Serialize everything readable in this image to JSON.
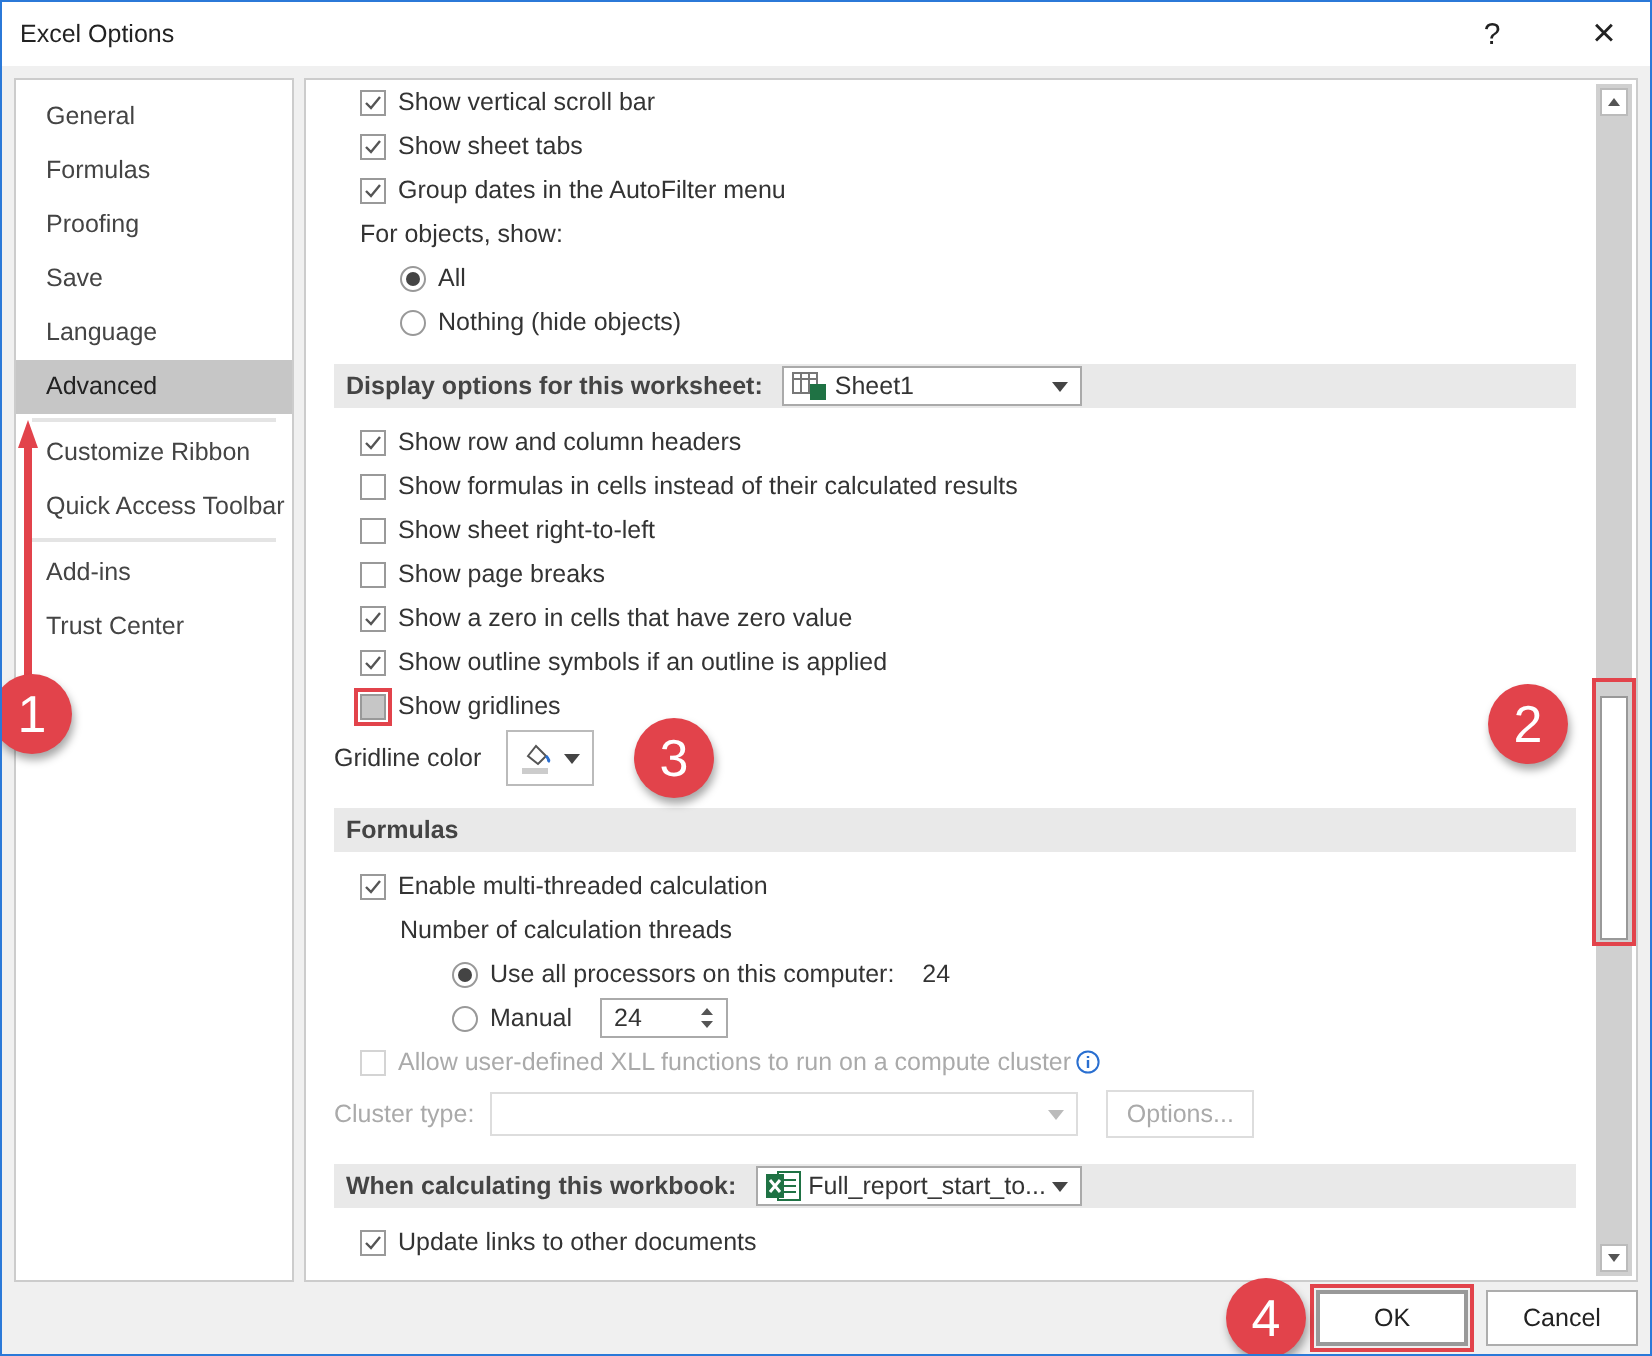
{
  "window": {
    "title": "Excel Options",
    "help": "?",
    "close": "×"
  },
  "sidebar": {
    "groups": [
      [
        {
          "label": "General",
          "selected": false
        },
        {
          "label": "Formulas",
          "selected": false
        },
        {
          "label": "Proofing",
          "selected": false
        },
        {
          "label": "Save",
          "selected": false
        },
        {
          "label": "Language",
          "selected": false
        },
        {
          "label": "Advanced",
          "selected": true
        }
      ],
      [
        {
          "label": "Customize Ribbon",
          "selected": false
        },
        {
          "label": "Quick Access Toolbar",
          "selected": false
        }
      ],
      [
        {
          "label": "Add-ins",
          "selected": false
        },
        {
          "label": "Trust Center",
          "selected": false
        }
      ]
    ]
  },
  "content": {
    "items": [
      {
        "kind": "checkbox",
        "label": "Show vertical scroll bar",
        "checked": true,
        "disabled": false,
        "highlighted": false
      },
      {
        "kind": "checkbox",
        "label": "Show sheet tabs",
        "checked": true,
        "disabled": false,
        "highlighted": false
      },
      {
        "kind": "checkbox",
        "label": "Group dates in the AutoFilter menu",
        "checked": true,
        "disabled": false,
        "highlighted": false
      },
      {
        "kind": "caption",
        "label": "For objects, show:",
        "children": [
          {
            "kind": "radio",
            "label": "All",
            "selected": true
          },
          {
            "kind": "radio",
            "label": "Nothing (hide objects)",
            "selected": false
          }
        ]
      },
      {
        "kind": "header",
        "label": "Display options for this worksheet:",
        "dropdown": {
          "kind": "worksheet",
          "value": "Sheet1"
        }
      },
      {
        "kind": "checkbox",
        "label": "Show row and column headers",
        "checked": true,
        "disabled": false,
        "highlighted": false
      },
      {
        "kind": "checkbox",
        "label": "Show formulas in cells instead of their calculated results",
        "checked": false,
        "disabled": false,
        "highlighted": false
      },
      {
        "kind": "checkbox",
        "label": "Show sheet right-to-left",
        "checked": false,
        "disabled": false,
        "highlighted": false
      },
      {
        "kind": "checkbox",
        "label": "Show page breaks",
        "checked": false,
        "disabled": false,
        "highlighted": false
      },
      {
        "kind": "checkbox",
        "label": "Show a zero in cells that have zero value",
        "checked": true,
        "disabled": false,
        "highlighted": false
      },
      {
        "kind": "checkbox",
        "label": "Show outline symbols if an outline is applied",
        "checked": true,
        "disabled": false,
        "highlighted": false
      },
      {
        "kind": "checkbox",
        "label": "Show gridlines",
        "checked": false,
        "disabled": false,
        "highlighted": true
      },
      {
        "kind": "color",
        "label": "Gridline color"
      },
      {
        "kind": "header",
        "label": "Formulas"
      },
      {
        "kind": "checkbox",
        "label": "Enable multi-threaded calculation",
        "checked": true,
        "disabled": false,
        "highlighted": false,
        "children": [
          {
            "kind": "caption",
            "label": "Number of calculation threads",
            "children": [
              {
                "kind": "radio",
                "label": "Use all processors on this computer:",
                "selected": true,
                "reading": "24"
              },
              {
                "kind": "radio",
                "label": "Manual",
                "selected": false,
                "spin_value": "24"
              }
            ]
          }
        ]
      },
      {
        "kind": "checkbox",
        "label": "Allow user-defined XLL functions to run on a compute cluster",
        "checked": false,
        "disabled": true,
        "highlighted": false,
        "info": true
      },
      {
        "kind": "cluster",
        "label": "Cluster type:",
        "button": "Options..."
      },
      {
        "kind": "header",
        "label": "When calculating this workbook:",
        "dropdown": {
          "kind": "workbook",
          "value": "Full_report_start_to..."
        }
      },
      {
        "kind": "checkbox",
        "label": "Update links to other documents",
        "checked": true,
        "disabled": false,
        "highlighted": false
      }
    ]
  },
  "buttons": [
    {
      "label": "OK",
      "highlighted": true
    },
    {
      "label": "Cancel",
      "highlighted": false
    }
  ],
  "callouts": [
    "1",
    "2",
    "3",
    "4"
  ]
}
